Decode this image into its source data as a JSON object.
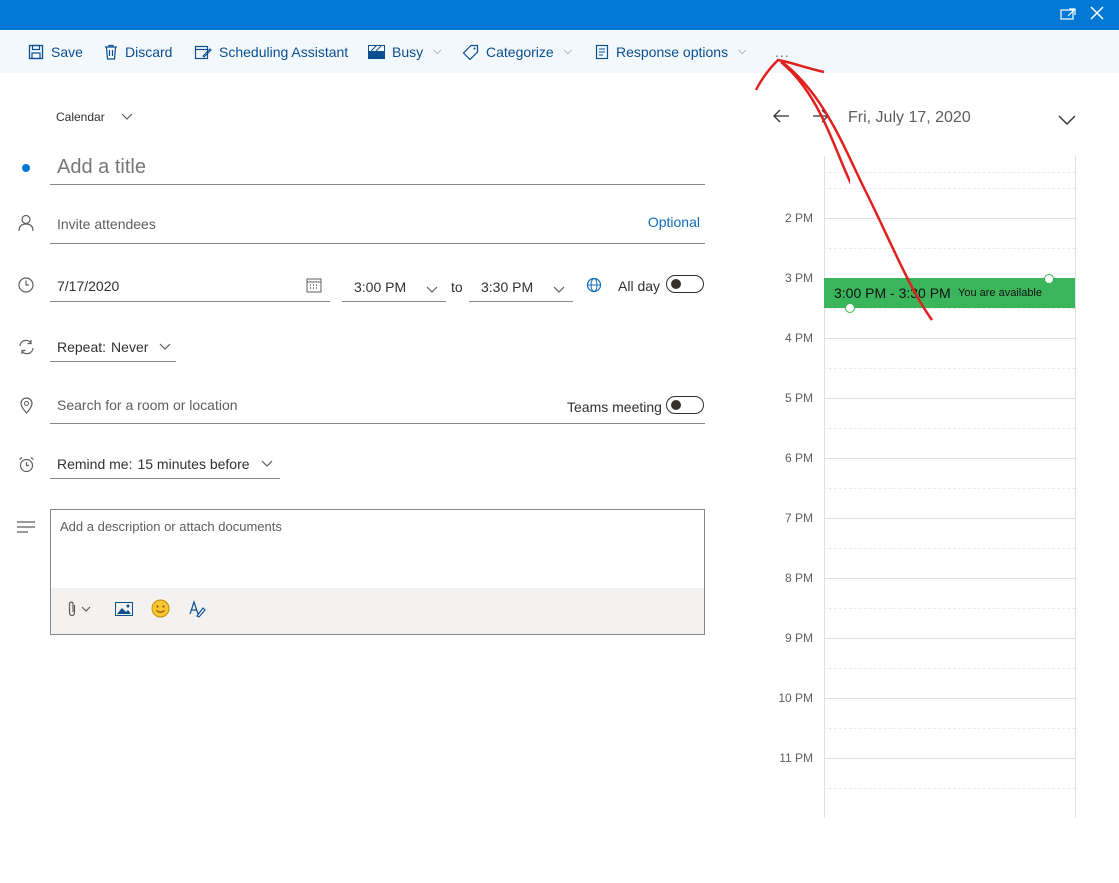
{
  "window": {
    "popout_icon": "popout-icon",
    "close_icon": "close-icon"
  },
  "toolbar": {
    "save": "Save",
    "discard": "Discard",
    "scheduling": "Scheduling Assistant",
    "busy": "Busy",
    "categorize": "Categorize",
    "response": "Response options",
    "more": "..."
  },
  "form": {
    "calendar_label": "Calendar",
    "title_placeholder": "Add a title",
    "attendees_placeholder": "Invite attendees",
    "optional_label": "Optional",
    "date": "7/17/2020",
    "start_time": "3:00 PM",
    "to_label": "to",
    "end_time": "3:30 PM",
    "allday_label": "All day",
    "repeat_prefix": "Repeat:",
    "repeat_value": "Never",
    "location_placeholder": "Search for a room or location",
    "teams_label": "Teams meeting",
    "remind_prefix": "Remind me:",
    "remind_value": "15 minutes before",
    "description_placeholder": "Add a description or attach documents"
  },
  "day_view": {
    "date_label": "Fri, July 17, 2020",
    "hours": [
      "2 PM",
      "3 PM",
      "4 PM",
      "5 PM",
      "6 PM",
      "7 PM",
      "8 PM",
      "9 PM",
      "10 PM",
      "11 PM"
    ],
    "event_time": "3:00 PM - 3:30 PM",
    "event_status": "You are available"
  },
  "colors": {
    "accent": "#0078d4",
    "event_green": "#3bb55c",
    "annotation_red": "#e0201e"
  }
}
